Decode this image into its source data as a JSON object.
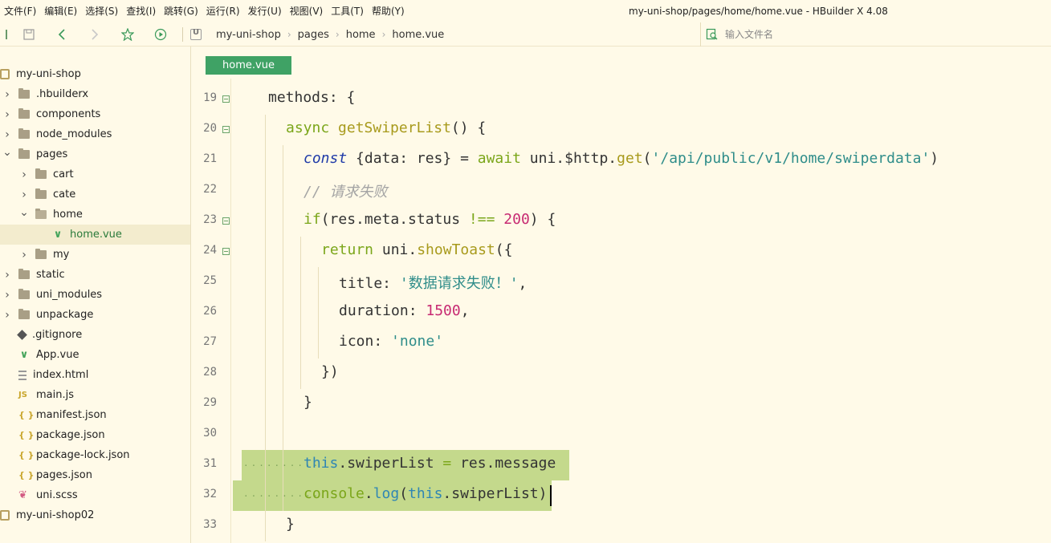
{
  "menu": [
    "文件(F)",
    "编辑(E)",
    "选择(S)",
    "查找(I)",
    "跳转(G)",
    "运行(R)",
    "发行(U)",
    "视图(V)",
    "工具(T)",
    "帮助(Y)"
  ],
  "window_title": "my-uni-shop/pages/home/home.vue - HBuilder X 4.08",
  "toolbar": {
    "icons": [
      "sidebar-toggle-icon",
      "save-icon",
      "back-icon",
      "forward-icon",
      "favorite-icon",
      "run-icon"
    ],
    "breadcrumb": [
      "my-uni-shop",
      "pages",
      "home",
      "home.vue"
    ],
    "file_search_placeholder": "输入文件名"
  },
  "sidebar": {
    "tree": [
      {
        "label": "my-uni-shop",
        "type": "project",
        "depth": 0,
        "chevron": ""
      },
      {
        "label": ".hbuilderx",
        "type": "folder",
        "depth": 1,
        "chevron": "right"
      },
      {
        "label": "components",
        "type": "folder",
        "depth": 1,
        "chevron": "right"
      },
      {
        "label": "node_modules",
        "type": "folder",
        "depth": 1,
        "chevron": "right"
      },
      {
        "label": "pages",
        "type": "folder",
        "depth": 1,
        "chevron": "down"
      },
      {
        "label": "cart",
        "type": "folder",
        "depth": 2,
        "chevron": "right"
      },
      {
        "label": "cate",
        "type": "folder",
        "depth": 2,
        "chevron": "right"
      },
      {
        "label": "home",
        "type": "folder-open",
        "depth": 2,
        "chevron": "down"
      },
      {
        "label": "home.vue",
        "type": "vue",
        "depth": 3,
        "chevron": "",
        "selected": true
      },
      {
        "label": "my",
        "type": "folder",
        "depth": 2,
        "chevron": "right"
      },
      {
        "label": "static",
        "type": "folder",
        "depth": 1,
        "chevron": "right"
      },
      {
        "label": "uni_modules",
        "type": "folder",
        "depth": 1,
        "chevron": "right"
      },
      {
        "label": "unpackage",
        "type": "folder",
        "depth": 1,
        "chevron": "right"
      },
      {
        "label": ".gitignore",
        "type": "git",
        "depth": 1,
        "chevron": ""
      },
      {
        "label": "App.vue",
        "type": "vue",
        "depth": 1,
        "chevron": ""
      },
      {
        "label": "index.html",
        "type": "file",
        "depth": 1,
        "chevron": ""
      },
      {
        "label": "main.js",
        "type": "js",
        "depth": 1,
        "chevron": ""
      },
      {
        "label": "manifest.json",
        "type": "json",
        "depth": 1,
        "chevron": ""
      },
      {
        "label": "package.json",
        "type": "json",
        "depth": 1,
        "chevron": ""
      },
      {
        "label": "package-lock.json",
        "type": "json",
        "depth": 1,
        "chevron": ""
      },
      {
        "label": "pages.json",
        "type": "json",
        "depth": 1,
        "chevron": ""
      },
      {
        "label": "uni.scss",
        "type": "scss",
        "depth": 1,
        "chevron": ""
      },
      {
        "label": "my-uni-shop02",
        "type": "project",
        "depth": 0,
        "chevron": ""
      }
    ]
  },
  "editor": {
    "tab_label": "home.vue",
    "lines": [
      {
        "num": "19",
        "fold": true,
        "indent": 2,
        "tokens": [
          [
            "methods: {",
            "default"
          ]
        ]
      },
      {
        "num": "20",
        "fold": true,
        "indent": 3,
        "tokens": [
          [
            "async ",
            "kw2"
          ],
          [
            "getSwiperList",
            "fn"
          ],
          [
            "() {",
            "default"
          ]
        ]
      },
      {
        "num": "21",
        "fold": false,
        "indent": 4,
        "tokens": [
          [
            "const",
            "kw"
          ],
          [
            " {data: res} = ",
            "default"
          ],
          [
            "await",
            "kw2"
          ],
          [
            " uni.$http.",
            "default"
          ],
          [
            "get",
            "fn"
          ],
          [
            "(",
            "default"
          ],
          [
            "'/api/public/v1/home/swiperdata'",
            "str"
          ],
          [
            ")",
            "default"
          ]
        ]
      },
      {
        "num": "22",
        "fold": false,
        "indent": 4,
        "tokens": [
          [
            "// 请求失败",
            "cmt"
          ]
        ]
      },
      {
        "num": "23",
        "fold": true,
        "indent": 4,
        "tokens": [
          [
            "if",
            "kw2"
          ],
          [
            "(res.meta.status ",
            "default"
          ],
          [
            "!==",
            "kw2"
          ],
          [
            " ",
            "default"
          ],
          [
            "200",
            "num"
          ],
          [
            ") {",
            "default"
          ]
        ]
      },
      {
        "num": "24",
        "fold": true,
        "indent": 5,
        "tokens": [
          [
            "return",
            "kw2"
          ],
          [
            " uni.",
            "default"
          ],
          [
            "showToast",
            "fn"
          ],
          [
            "({",
            "default"
          ]
        ]
      },
      {
        "num": "25",
        "fold": false,
        "indent": 6,
        "tokens": [
          [
            "title: ",
            "default"
          ],
          [
            "'数据请求失败！'",
            "str"
          ],
          [
            ",",
            "default"
          ]
        ]
      },
      {
        "num": "26",
        "fold": false,
        "indent": 6,
        "tokens": [
          [
            "duration: ",
            "default"
          ],
          [
            "1500",
            "num"
          ],
          [
            ",",
            "default"
          ]
        ]
      },
      {
        "num": "27",
        "fold": false,
        "indent": 6,
        "tokens": [
          [
            "icon: ",
            "default"
          ],
          [
            "'none'",
            "str"
          ]
        ]
      },
      {
        "num": "28",
        "fold": false,
        "indent": 5,
        "tokens": [
          [
            "})",
            "default"
          ]
        ]
      },
      {
        "num": "29",
        "fold": false,
        "indent": 4,
        "tokens": [
          [
            "}",
            "default"
          ]
        ]
      },
      {
        "num": "30",
        "fold": false,
        "indent": 4,
        "tokens": []
      },
      {
        "num": "31",
        "fold": false,
        "indent": 4,
        "highlight": true,
        "tokens": [
          [
            "this",
            "this"
          ],
          [
            ".swiperList ",
            "default"
          ],
          [
            "=",
            "kw2"
          ],
          [
            " res.message",
            "default"
          ]
        ]
      },
      {
        "num": "32",
        "fold": false,
        "indent": 4,
        "highlight": true,
        "cursor": true,
        "tokens": [
          [
            "console",
            "kw2"
          ],
          [
            ".",
            "default"
          ],
          [
            "log",
            "this"
          ],
          [
            "(",
            "default"
          ],
          [
            "this",
            "this"
          ],
          [
            ".swiperList)",
            "default"
          ]
        ]
      },
      {
        "num": "33",
        "fold": false,
        "indent": 3,
        "tokens": [
          [
            "}",
            "default"
          ]
        ]
      }
    ]
  }
}
